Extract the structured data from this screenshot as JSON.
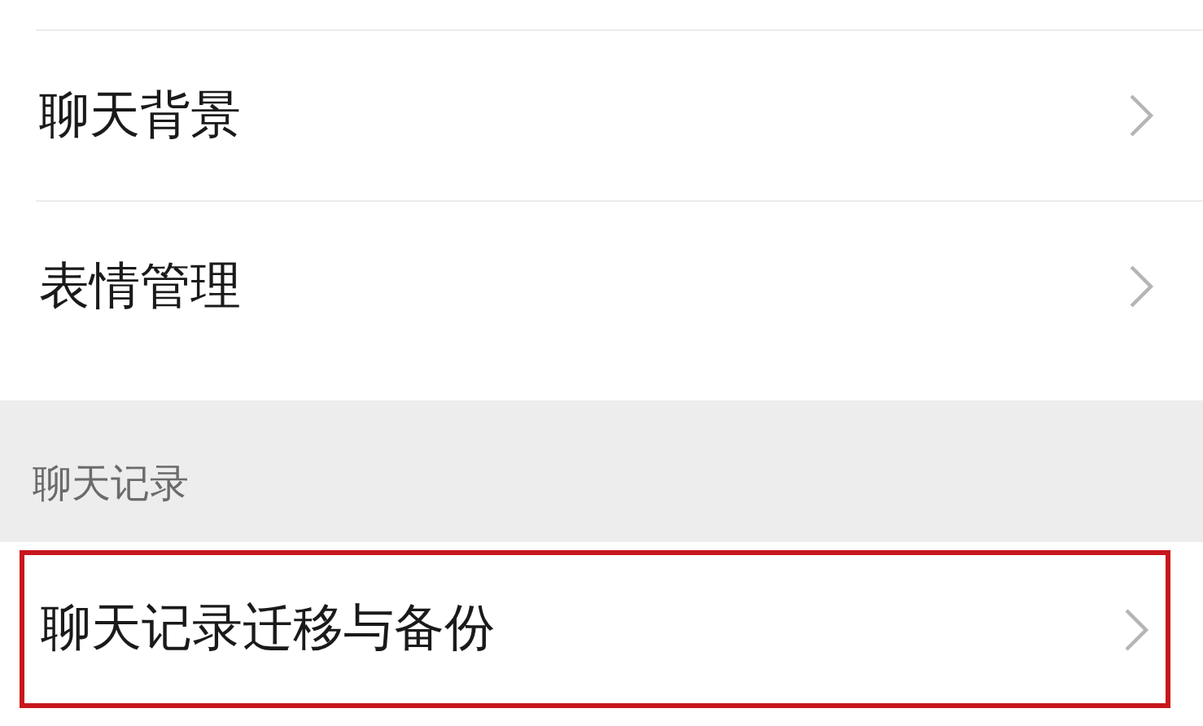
{
  "groups": [
    {
      "items": [
        {
          "label": "聊天背景",
          "highlighted": false
        },
        {
          "label": "表情管理",
          "highlighted": false
        }
      ]
    },
    {
      "header": "聊天记录",
      "items": [
        {
          "label": "聊天记录迁移与备份",
          "highlighted": true
        }
      ]
    }
  ]
}
